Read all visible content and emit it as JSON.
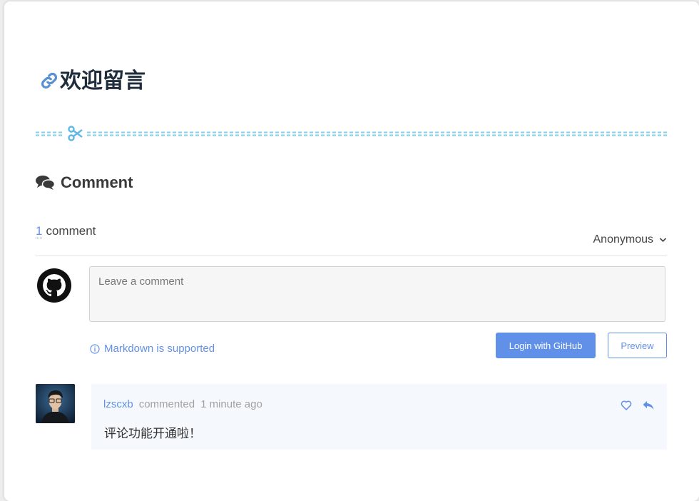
{
  "page": {
    "title": "欢迎留言"
  },
  "comment_section": {
    "heading": "Comment",
    "count_number": "1",
    "count_label": "comment",
    "identity_selector": "Anonymous",
    "textarea_placeholder": "Leave a comment",
    "markdown_hint": "Markdown is supported",
    "login_button": "Login with GitHub",
    "preview_button": "Preview"
  },
  "comments": [
    {
      "user": "lzscxb",
      "action": "commented",
      "time": "1 minute ago",
      "body": "评论功能开通啦！"
    }
  ],
  "colors": {
    "accent": "#6190e8",
    "divider": "#87ceeb",
    "comment_bg": "#f5f9fe"
  },
  "icons": [
    "link-icon",
    "scissors-icon",
    "comments-icon",
    "chevron-down-icon",
    "github-icon",
    "info-icon",
    "heart-icon",
    "reply-icon"
  ]
}
